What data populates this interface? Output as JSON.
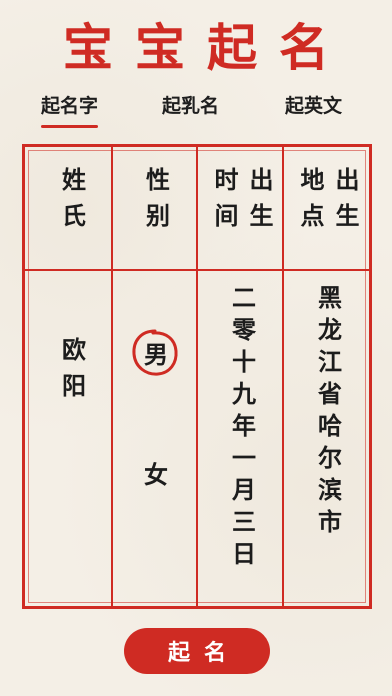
{
  "app": {
    "title": "宝宝起名"
  },
  "tabs": [
    {
      "label": "起名字",
      "active": true
    },
    {
      "label": "起乳名",
      "active": false
    },
    {
      "label": "起英文",
      "active": false
    }
  ],
  "table": {
    "headers": [
      "姓氏",
      "性别",
      "出生时间",
      "出生地点"
    ],
    "header_lines": [
      [
        "姓氏"
      ],
      [
        "性别"
      ],
      [
        "时间",
        "出生"
      ],
      [
        "地点",
        "出生"
      ]
    ],
    "surname": "欧阳",
    "gender_options": [
      {
        "label": "男",
        "selected": true
      },
      {
        "label": "女",
        "selected": false
      }
    ],
    "birth_time": "二零十九年一月三日",
    "birth_place": "黑龙江省哈尔滨市"
  },
  "actions": {
    "submit_label": "起名"
  },
  "colors": {
    "accent": "#cf2b23",
    "background": "#f4efe6",
    "text": "#1c1c1c"
  }
}
